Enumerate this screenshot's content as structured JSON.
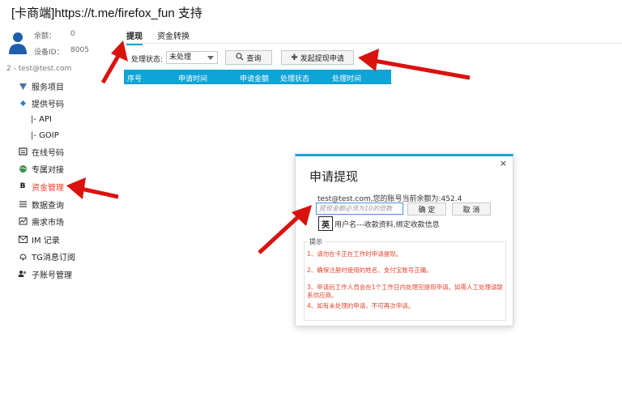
{
  "window": {
    "title": "[卡商端]https://t.me/firefox_fun 支持"
  },
  "account": {
    "balance_label": "余额：",
    "balance_value": "0",
    "device_label": "设备ID：",
    "device_value": "8005",
    "user_line": "2 - test@test.com"
  },
  "sidebar": {
    "items": [
      {
        "label": "服务项目",
        "icon": "service-icon"
      },
      {
        "label": "提供号码",
        "icon": "dropdown-diamond-icon"
      },
      {
        "label": "|-  API",
        "icon": ""
      },
      {
        "label": "|-  GOIP",
        "icon": ""
      },
      {
        "label": "在线号码",
        "icon": "online-number-icon"
      },
      {
        "label": "专属对接",
        "icon": "globe-icon"
      },
      {
        "label": "资金管理",
        "icon": "bold-b-icon"
      },
      {
        "label": "数据查询",
        "icon": "list-icon"
      },
      {
        "label": "需求市场",
        "icon": "chart-icon"
      },
      {
        "label": "IM 记录",
        "icon": "mail-icon"
      },
      {
        "label": "TG消息订阅",
        "icon": "bell-icon"
      },
      {
        "label": "子账号管理",
        "icon": "users-icon"
      }
    ]
  },
  "tabs": [
    {
      "label": "提现",
      "active": true
    },
    {
      "label": "资金转换",
      "active": false
    }
  ],
  "toolbar": {
    "status_label": "处理状态:",
    "status_value": "未处理",
    "query_label": "查询",
    "apply_label": "发起提现申请"
  },
  "table": {
    "columns": [
      "序号",
      "申请时间",
      "申请金额",
      "处理状态",
      "处理时间"
    ]
  },
  "dialog": {
    "title": "申请提现",
    "close": "×",
    "message": "test@test.com,您的账号当前余额为:452.4",
    "amount_placeholder": "提现金额必须为10的倍数",
    "confirm_label": "确 定",
    "cancel_label": "取 消",
    "ime_label": "英",
    "bind_text": "用户名---收款资料,绑定收款信息",
    "tips_title": "提示",
    "tips": [
      "1、请勿在卡正在工作时申请提现。",
      "2、确保注册时使用的姓名、支付宝账号正确。",
      "3、申请后工作人员会在1个工作日内处理完提现申请。如需人工处理请联系供应商。",
      "4、如有未处理的申请，不可再次申请。"
    ]
  },
  "colors": {
    "accent": "#1aa3d8",
    "table_header": "#0fa3d8",
    "active_nav": "#e0432b",
    "tip_text": "#e0432b",
    "arrow": "#d9120f"
  }
}
